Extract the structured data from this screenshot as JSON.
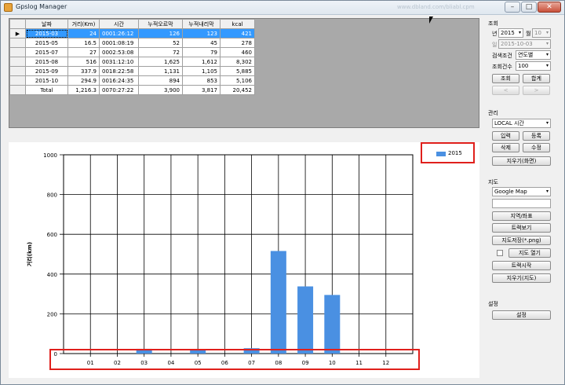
{
  "window": {
    "title": "Gpslog Manager",
    "watermark": "www.dbland.com/bliabl.cpm"
  },
  "grid": {
    "headers": [
      "날짜",
      "거리(Km)",
      "시간",
      "누적오르막",
      "누적내리막",
      "kcal"
    ],
    "rows": [
      [
        "2015-03",
        "24",
        "0001:26:12",
        "126",
        "123",
        "421"
      ],
      [
        "2015-05",
        "16.5",
        "0001:08:19",
        "52",
        "45",
        "278"
      ],
      [
        "2015-07",
        "27",
        "0002:53:08",
        "72",
        "79",
        "460"
      ],
      [
        "2015-08",
        "516",
        "0031:12:10",
        "1,625",
        "1,612",
        "8,302"
      ],
      [
        "2015-09",
        "337.9",
        "0018:22:58",
        "1,131",
        "1,105",
        "5,885"
      ],
      [
        "2015-10",
        "294.9",
        "0016:24:35",
        "894",
        "853",
        "5,106"
      ],
      [
        "Total",
        "1,216.3",
        "0070:27:22",
        "3,900",
        "3,817",
        "20,452"
      ]
    ]
  },
  "right_panel": {
    "query": {
      "section": "조회",
      "year_label": "년",
      "year_value": "2015",
      "month_label": "월",
      "month_value": "10",
      "day_label": "일",
      "day_value": "2015-10-03",
      "criteria_label": "검색조건",
      "criteria_value": "연도별",
      "count_label": "조회건수",
      "count_value": "100",
      "query_button": "조회",
      "sum_button": "합계",
      "prev_button": "<",
      "next_button": ">"
    },
    "manage": {
      "section": "관리",
      "time_value": "LOCAL 시간",
      "input_button": "입력",
      "register_button": "등록",
      "delete_button": "삭제",
      "edit_button": "수정",
      "clear_screen_button": "지우기(화면)"
    },
    "map": {
      "section": "지도",
      "map_value": "Google Map",
      "search_value": "",
      "region_button": "지역/좌표",
      "track_view_button": "트랙보기",
      "save_map_button": "지도저장(*.png)",
      "open_map_button": "지도 열기",
      "track_start_button": "트랙시작",
      "clear_map_button": "지우기(지도)"
    },
    "settings": {
      "section": "설정",
      "settings_button": "설정"
    }
  },
  "colors": {
    "bar": "#4a90e2",
    "selection": "#3399ff",
    "highlight": "#e0201c"
  },
  "chart_data": {
    "type": "bar",
    "categories": [
      "01",
      "02",
      "03",
      "04",
      "05",
      "06",
      "07",
      "08",
      "09",
      "10",
      "11",
      "12"
    ],
    "series": [
      {
        "name": "2015",
        "values": [
          0,
          0,
          24,
          0,
          16.5,
          0,
          27,
          516,
          337.9,
          294.9,
          0,
          0
        ]
      }
    ],
    "ylabel": "거리(km)",
    "yticks": [
      0,
      200,
      400,
      600,
      800,
      1000
    ],
    "ylim": [
      0,
      1000
    ],
    "grid": true,
    "legend": "top-right"
  }
}
